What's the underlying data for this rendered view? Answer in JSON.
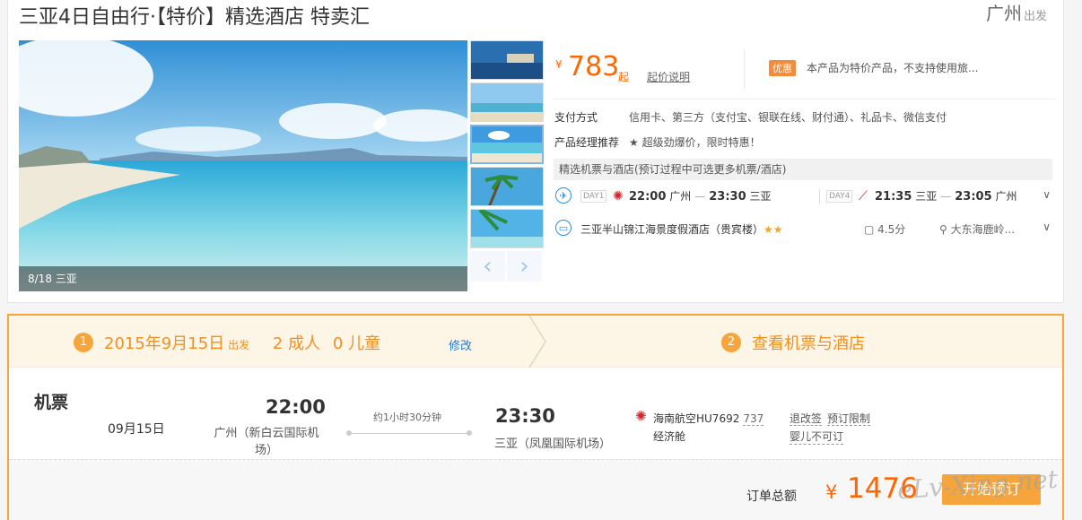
{
  "product": {
    "title": "三亚4日自由行·【特价】精选酒店 特卖汇",
    "departure_city": "广州",
    "departure_suffix": "出发",
    "gallery_caption": "8/18 三亚",
    "price_symbol": "¥",
    "price": "783",
    "price_suffix": "起",
    "price_explain": "起价说明",
    "promo_badge": "优惠",
    "promo_text": "本产品为特价产品，不支持使用旅...",
    "payment_label": "支付方式",
    "payment_value": "信用卡、第三方（支付宝、银联在线、财付通）、礼品卡、微信支付",
    "manager_label": "产品经理推荐",
    "manager_value": "★ 超级劲爆价，限时特惠！",
    "selection_note": "精选机票与酒店(预订过程中可选更多机票/酒店)",
    "outbound": {
      "day": "DAY1",
      "dep_time": "22:00",
      "dep_city": "广州",
      "arr_time": "23:30",
      "arr_city": "三亚"
    },
    "return": {
      "day": "DAY4",
      "dep_time": "21:35",
      "dep_city": "三亚",
      "arr_time": "23:05",
      "arr_city": "广州"
    },
    "hotel": {
      "name": "三亚半山锦江海景度假酒店（贵宾楼）",
      "stars": "★★",
      "score": "4.5分",
      "address": "大东海鹿岭..."
    }
  },
  "booking": {
    "step1": {
      "num": "1",
      "date": "2015年9月15日",
      "date_suffix": "出发",
      "adults": "2 成人",
      "children": "0 儿童",
      "modify": "修改"
    },
    "step2": {
      "num": "2",
      "label": "查看机票与酒店"
    },
    "flight": {
      "section_label": "机票",
      "date": "09月15日",
      "dep_time": "22:00",
      "dep_airport": "广州（新白云国际机场）",
      "duration": "约1小时30分钟",
      "arr_time": "23:30",
      "arr_airport": "三亚（凤凰国际机场）",
      "airline": "海南航空HU7692",
      "plane": "737",
      "cabin": "经济舱",
      "rule_change": "退改签",
      "rule_booking": "预订限制",
      "rule_infant": "婴儿不可订"
    },
    "total_label": "订单总额",
    "total_symbol": "¥",
    "total": "1476",
    "book_button": "开始预订"
  },
  "watermark": "eLv-Xing.net"
}
